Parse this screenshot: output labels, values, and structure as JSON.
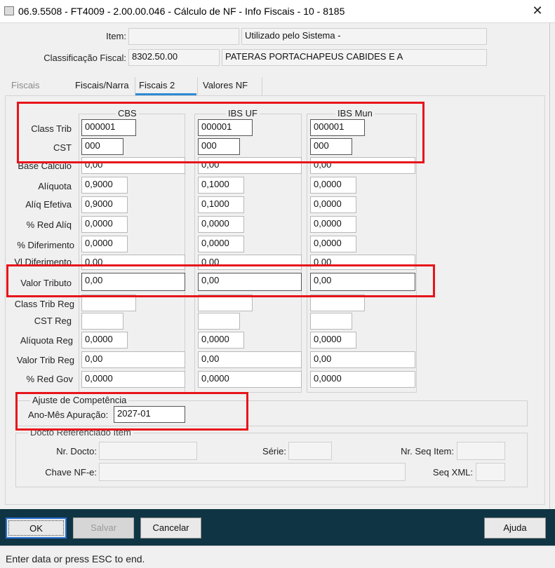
{
  "window": {
    "title": "06.9.5508 - FT4009 - 2.00.00.046 - Cálculo de NF - Info Fiscais - 10 - 8185",
    "close_symbol": "✕"
  },
  "header": {
    "item_label": "Item:",
    "item_value": "",
    "item_desc": "Utilizado pelo Sistema -",
    "class_fiscal_label": "Classificação Fiscal:",
    "class_fiscal_value": "8302.50.00",
    "class_fiscal_desc": "PATERAS PORTACHAPEUS CABIDES E A"
  },
  "tabs": [
    {
      "label": "Fiscais",
      "state": "disabled"
    },
    {
      "label": "Fiscais/Narra",
      "state": "normal"
    },
    {
      "label": "Fiscais 2",
      "state": "selected"
    },
    {
      "label": "Valores NF",
      "state": "normal"
    }
  ],
  "columns": [
    "CBS",
    "IBS UF",
    "IBS Mun"
  ],
  "rows": {
    "class_trib": {
      "label": "Class Trib",
      "values": [
        "000001",
        "000001",
        "000001"
      ]
    },
    "cst": {
      "label": "CST",
      "values": [
        "000",
        "000",
        "000"
      ]
    },
    "base_calculo": {
      "label": "Base Cálculo",
      "values": [
        "0,00",
        "0,00",
        "0,00"
      ]
    },
    "aliquota": {
      "label": "Alíquota",
      "values": [
        "0,9000",
        "0,1000",
        "0,0000"
      ]
    },
    "aliq_efetiva": {
      "label": "Alíq Efetiva",
      "values": [
        "0,9000",
        "0,1000",
        "0,0000"
      ]
    },
    "red_aliq": {
      "label": "% Red Alíq",
      "values": [
        "0,0000",
        "0,0000",
        "0,0000"
      ]
    },
    "diferimento": {
      "label": "% Diferimento",
      "values": [
        "0,0000",
        "0,0000",
        "0,0000"
      ]
    },
    "vl_diferimento": {
      "label": "Vl Diferimento",
      "values": [
        "0,00",
        "0,00",
        "0,00"
      ]
    },
    "valor_tributo": {
      "label": "Valor Tributo",
      "values": [
        "0,00",
        "0,00",
        "0,00"
      ]
    },
    "class_trib_reg": {
      "label": "Class Trib Reg",
      "values": [
        "",
        "",
        ""
      ]
    },
    "cst_reg": {
      "label": "CST Reg",
      "values": [
        "",
        "",
        ""
      ]
    },
    "aliquota_reg": {
      "label": "Alíquota Reg",
      "values": [
        "0,0000",
        "0,0000",
        "0,0000"
      ]
    },
    "valor_trib_reg": {
      "label": "Valor Trib Reg",
      "values": [
        "0,00",
        "0,00",
        "0,00"
      ]
    },
    "red_gov": {
      "label": "% Red Gov",
      "values": [
        "0,0000",
        "0,0000",
        "0,0000"
      ]
    }
  },
  "ajuste": {
    "title": "Ajuste de Competência",
    "ano_mes_label": "Ano-Mês Apuração:",
    "ano_mes_value": "2027-01"
  },
  "docto": {
    "title": "Docto Referenciado Item",
    "nr_docto_label": "Nr. Docto:",
    "nr_docto_value": "",
    "serie_label": "Série:",
    "serie_value": "",
    "nr_seq_label": "Nr. Seq Item:",
    "nr_seq_value": "",
    "chave_label": "Chave NF-e:",
    "chave_value": "",
    "seq_xml_label": "Seq XML:",
    "seq_xml_value": ""
  },
  "buttons": {
    "ok": "OK",
    "salvar": "Salvar",
    "cancelar": "Cancelar",
    "ajuda": "Ajuda"
  },
  "status": {
    "text": "Enter data or press ESC to end."
  },
  "colors": {
    "footer_bg": "#0f3544",
    "highlight": "#e8141b",
    "tab_accent": "#2b8ad4"
  }
}
